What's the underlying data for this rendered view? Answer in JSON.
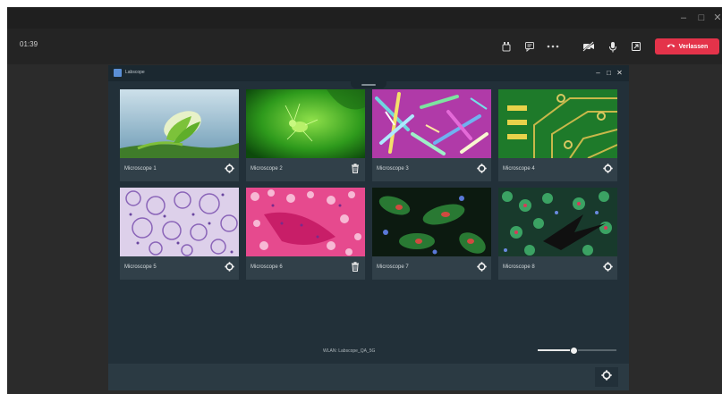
{
  "meeting": {
    "timer": "01:39",
    "leave_label": "Verlassen",
    "window_controls": [
      "minimize-icon",
      "maximize-icon",
      "close-icon"
    ],
    "toolbar_icons": [
      "participants-icon",
      "chat-icon",
      "more-icon",
      "camera-off-icon",
      "microphone-icon",
      "share-icon"
    ],
    "accent_color": "#e4334a"
  },
  "app": {
    "title": "Labscope",
    "footer_text": "WLAN: Labscope_QA_5G",
    "zoom_level": 0.45,
    "microscopes": [
      {
        "label": "Microscope 1",
        "action_icon": "settings-icon"
      },
      {
        "label": "Microscope 2",
        "action_icon": "trash-icon"
      },
      {
        "label": "Microscope 3",
        "action_icon": "settings-icon"
      },
      {
        "label": "Microscope 4",
        "action_icon": "settings-icon"
      },
      {
        "label": "Microscope 5",
        "action_icon": "settings-icon"
      },
      {
        "label": "Microscope 6",
        "action_icon": "trash-icon"
      },
      {
        "label": "Microscope 7",
        "action_icon": "settings-icon"
      },
      {
        "label": "Microscope 8",
        "action_icon": "settings-icon"
      }
    ]
  }
}
